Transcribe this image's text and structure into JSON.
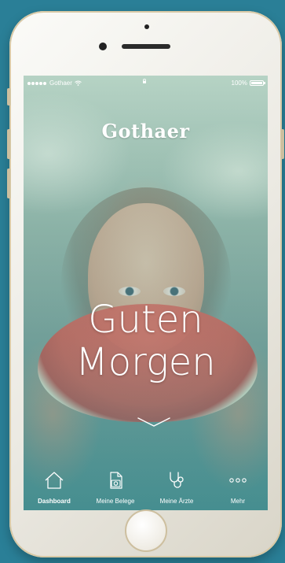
{
  "status_bar": {
    "carrier": "Gothaer",
    "battery_percent": "100%",
    "battery_level": 1.0
  },
  "brand": {
    "logo_text": "Gothaer"
  },
  "hero": {
    "greeting_line1": "Guten",
    "greeting_line2": "Morgen",
    "scroll_icon": "chevron-down-icon"
  },
  "tabbar": {
    "items": [
      {
        "label": "Dashboard",
        "icon": "home-icon",
        "active": true
      },
      {
        "label": "Meine Belege",
        "icon": "camera-document-icon",
        "active": false
      },
      {
        "label": "Meine Ärzte",
        "icon": "stethoscope-icon",
        "active": false
      },
      {
        "label": "Mehr",
        "icon": "more-dots-icon",
        "active": false
      }
    ]
  },
  "colors": {
    "background": "#2a7f97",
    "text_on_photo": "#ffffff",
    "phone_frame": "#f3f1ea",
    "phone_accent": "#cdbf9f"
  }
}
